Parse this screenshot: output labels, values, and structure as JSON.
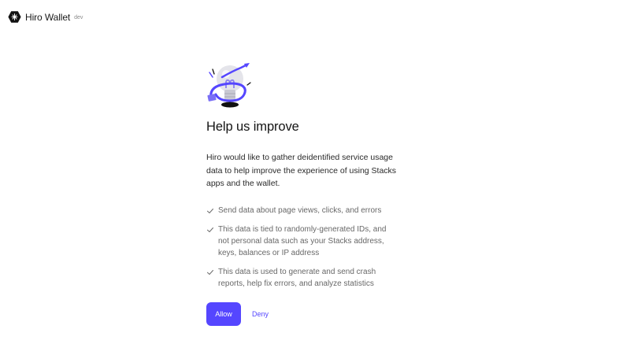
{
  "header": {
    "brand": "Hiro Wallet",
    "env": "dev",
    "logo_icon": "hiro-logo-icon"
  },
  "main": {
    "illustration_icon": "lightbulb-illustration-icon",
    "title": "Help us improve",
    "intro": "Hiro would like to gather deidentified service usage data to help improve the experience of using Stacks apps and the wallet.",
    "items": [
      {
        "icon": "check-icon",
        "text": "Send data about page views, clicks, and errors"
      },
      {
        "icon": "check-icon",
        "text": "This data is tied to randomly-generated IDs, and not personal data such as your Stacks address, keys, balances or IP address"
      },
      {
        "icon": "check-icon",
        "text": "This data is used to generate and send crash reports, help fix errors, and analyze statistics"
      }
    ],
    "allow_label": "Allow",
    "deny_label": "Deny"
  },
  "colors": {
    "accent": "#5546ff",
    "muted_text": "#686868"
  }
}
